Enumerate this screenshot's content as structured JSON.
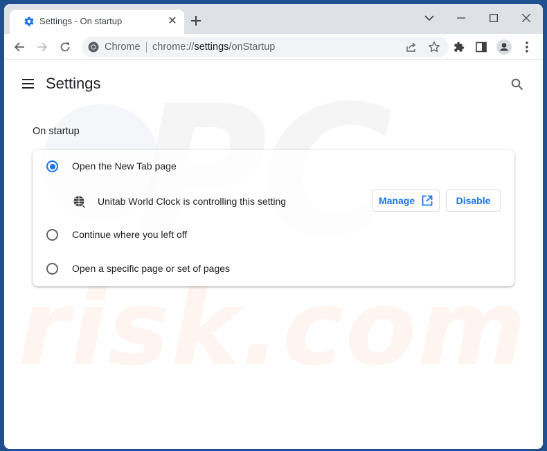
{
  "browser": {
    "tab": {
      "title": "Settings - On startup",
      "favicon": "gear-icon",
      "close_icon": "close-icon"
    },
    "new_tab_icon": "plus-icon",
    "window_controls": [
      "chevron-down-icon",
      "minimize-icon",
      "maximize-icon",
      "close-icon"
    ],
    "toolbar": {
      "nav_icons": [
        "back-arrow-icon",
        "forward-arrow-icon",
        "reload-icon"
      ],
      "omnibox": {
        "site_chip": "Chrome",
        "url_prefix": "chrome://",
        "url_host": "settings",
        "url_path": "/onStartup",
        "icons": [
          "share-icon",
          "star-icon"
        ]
      },
      "right_icons": [
        "extensions-puzzle-icon",
        "side-panel-icon",
        "profile-avatar-icon",
        "more-vert-icon"
      ]
    }
  },
  "settings": {
    "header": {
      "menu_icon": "hamburger-menu-icon",
      "title": "Settings",
      "search_icon": "search-icon"
    },
    "section": {
      "title": "On startup",
      "options": [
        {
          "label": "Open the New Tab page",
          "checked": true
        },
        {
          "label": "Continue where you left off",
          "checked": false
        },
        {
          "label": "Open a specific page or set of pages",
          "checked": false
        }
      ],
      "extension_notice": {
        "icon": "extension-globe-icon",
        "text": "Unitab World Clock is controlling this setting",
        "manage_label": "Manage",
        "manage_icon": "open-in-new-icon",
        "disable_label": "Disable"
      }
    }
  },
  "watermark": {
    "top": "PC",
    "bottom": "risk.com"
  },
  "colors": {
    "accent": "#1a73e8",
    "frame": "#1f4f8f",
    "tabstrip": "#dee1e6"
  }
}
